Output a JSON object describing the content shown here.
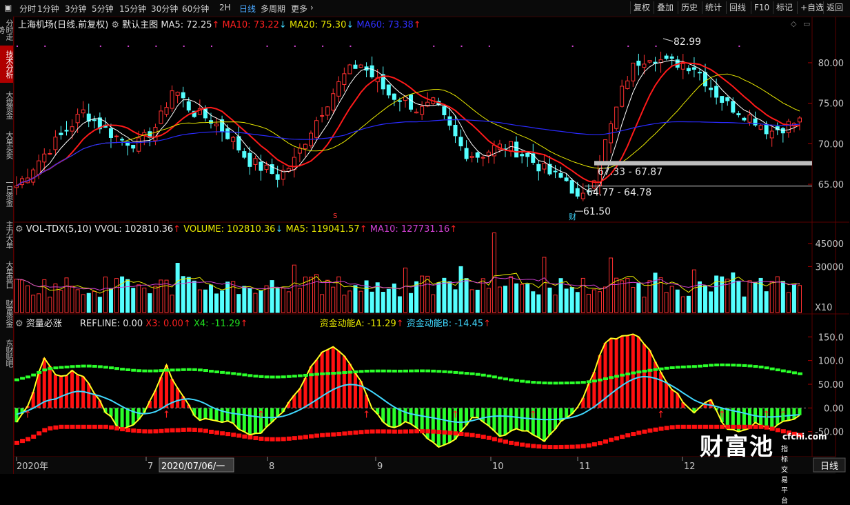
{
  "toolbar": {
    "periods": [
      "分时",
      "1分钟",
      "3分钟",
      "5分钟",
      "15分钟",
      "30分钟",
      "60分钟",
      "2H",
      "日线",
      "多周期",
      "更多"
    ],
    "active_period": "日线",
    "right_buttons": [
      "复权",
      "叠加",
      "历史",
      "统计",
      "回线",
      "F10",
      "标记",
      "+自选",
      "返回"
    ]
  },
  "sidebar": {
    "tabs": [
      "分时走势",
      "技术分析",
      "大盘资金",
      "大单买卖",
      "一日资金",
      "主力大单",
      "大单盘口",
      "财富资金",
      "东财贴吧"
    ],
    "active_tab": "技术分析"
  },
  "main_panel": {
    "stock_title": "上海机场(日线.前复权)",
    "template": "默认主图",
    "ma": [
      {
        "label": "MA5: 72.25",
        "arrow": "↑",
        "color": "#e8e8e8"
      },
      {
        "label": "MA10: 73.22",
        "arrow": "↓",
        "color": "#ff2020"
      },
      {
        "label": "MA20: 75.30",
        "arrow": "↓",
        "color": "#e8e800"
      },
      {
        "label": "MA60: 73.38",
        "arrow": "↑",
        "color": "#2020ff"
      }
    ],
    "annotations": {
      "high": "82.99",
      "low": "61.50",
      "gap1": "67.33 - 67.87",
      "gap2": "64.77 - 64.78",
      "cai_marker": "财",
      "s_marker": "S"
    }
  },
  "volume_panel": {
    "title": "VOL-TDX(5,10)",
    "items": [
      {
        "label": "VVOL: 102810.36",
        "arrow": "↑",
        "color": "#e8e8e8"
      },
      {
        "label": "VOLUME: 102810.36",
        "arrow": "↓",
        "color": "#e8e800"
      },
      {
        "label": "MA5: 119041.57",
        "arrow": "↑",
        "color": "#e8e800"
      },
      {
        "label": "MA10: 127731.16",
        "arrow": "↑",
        "color": "#d040d0"
      }
    ],
    "unit": "X10"
  },
  "fund_panel": {
    "title": "资量必涨",
    "items": [
      {
        "label": "REFLINE: 0.00",
        "color": "#e8e8e8",
        "arrow": ""
      },
      {
        "label": "X3: 0.00",
        "color": "#ff2020",
        "arrow": "↑"
      },
      {
        "label": "X4: -11.29",
        "color": "#20e020",
        "arrow": "↑"
      },
      {
        "label": "资金动能A: -11.29",
        "color": "#e8e800",
        "arrow": "↑"
      },
      {
        "label": "资金动能B: -14.45",
        "color": "#40d8ff",
        "arrow": "↑"
      }
    ]
  },
  "xaxis": {
    "labels": [
      "2020年",
      "7",
      "8",
      "9",
      "10",
      "11",
      "12"
    ],
    "cursor_date": "2020/07/06/一",
    "period_tag": "日线"
  },
  "logo": {
    "text": "财富池",
    "url": "cfchi.com",
    "sub": "指标交易平台"
  },
  "colors": {
    "up": "#ff3030",
    "down": "#54ffff",
    "bg": "#000000",
    "grid": "#5a0000"
  },
  "chart_data": [
    {
      "type": "candlestick",
      "name": "上海机场",
      "ylim": [
        61,
        84
      ],
      "yticks": [
        "80.00",
        "75.00",
        "70.00",
        "65.00"
      ],
      "key_levels": {
        "high": 82.99,
        "low": 61.5,
        "gap_zone_top": [
          67.33,
          67.87
        ],
        "gap_zone_bottom": [
          64.77,
          64.78
        ]
      },
      "ma_last": {
        "MA5": 72.25,
        "MA10": 73.22,
        "MA20": 75.3,
        "MA60": 73.38
      }
    },
    {
      "type": "bar",
      "name": "VOL-TDX",
      "yticks": [
        "45000",
        "30000"
      ],
      "last": {
        "VVOL": 102810.36,
        "MA5": 119041.57,
        "MA10": 127731.16
      }
    },
    {
      "type": "area",
      "name": "资量必涨",
      "ylim": [
        -100,
        160
      ],
      "yticks": [
        "150.0",
        "100.0",
        "50.00",
        "0.00",
        "-50.00"
      ],
      "last": {
        "REFLINE": 0.0,
        "X3": 0.0,
        "X4": -11.29,
        "A": -11.29,
        "B": -14.45
      }
    }
  ]
}
